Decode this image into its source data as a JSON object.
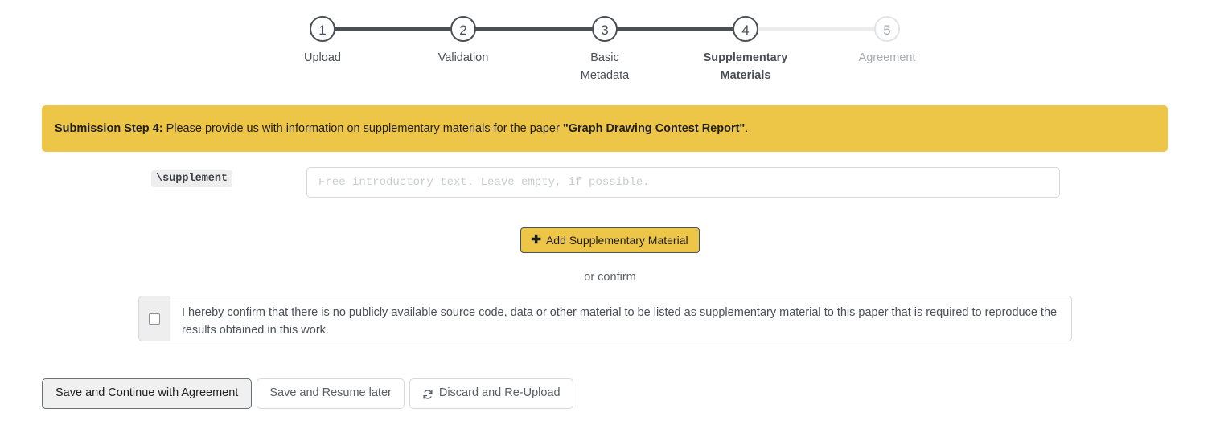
{
  "stepper": {
    "steps": [
      {
        "number": "1",
        "label": "Upload",
        "state": "done"
      },
      {
        "number": "2",
        "label": "Validation",
        "state": "done"
      },
      {
        "number": "3",
        "label": "Basic\nMetadata",
        "label_line1": "Basic",
        "label_line2": "Metadata",
        "state": "done"
      },
      {
        "number": "4",
        "label": "Supplementary Materials",
        "label_line1": "Supplementary",
        "label_line2": "Materials",
        "state": "current"
      },
      {
        "number": "5",
        "label": "Agreement",
        "state": "inactive"
      }
    ]
  },
  "alert": {
    "prefix": "Submission Step 4:",
    "text_before": " Please provide us with information on supplementary materials for the paper ",
    "paper_title": "\"Graph Drawing Contest Report\"",
    "text_after": ".",
    "background_color": "#edc547"
  },
  "supplement_field": {
    "label": "\\supplement",
    "value": "",
    "placeholder": "Free introductory text. Leave empty, if possible."
  },
  "add_button": {
    "icon": "plus-icon",
    "glyph": "✚",
    "label": "Add Supplementary Material",
    "background_color": "#edc547"
  },
  "or_confirm": {
    "text": "or confirm"
  },
  "confirm_checkbox": {
    "checked": false,
    "text": "I hereby confirm that there is no publicly available source code, data or other material to be listed as supplementary material to this paper that is required to reproduce the results obtained in this work."
  },
  "footer": {
    "save_continue_label": "Save and Continue with Agreement",
    "save_resume_label": "Save and Resume later",
    "discard_label": "Discard and Re-Upload",
    "discard_icon": "refresh-icon"
  }
}
